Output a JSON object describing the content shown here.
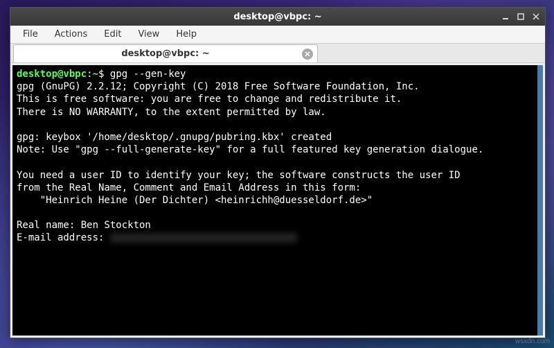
{
  "window": {
    "title": "desktop@vbpc: ~"
  },
  "menubar": {
    "items": [
      "File",
      "Actions",
      "Edit",
      "View",
      "Help"
    ]
  },
  "tab": {
    "label": "desktop@vbpc: ~"
  },
  "terminal": {
    "prompt_user": "desktop@vbpc",
    "prompt_path": "~",
    "prompt_symbol": "$",
    "command": "gpg --gen-key",
    "lines": [
      "gpg (GnuPG) 2.2.12; Copyright (C) 2018 Free Software Foundation, Inc.",
      "This is free software: you are free to change and redistribute it.",
      "There is NO WARRANTY, to the extent permitted by law.",
      "",
      "gpg: keybox '/home/desktop/.gnupg/pubring.kbx' created",
      "Note: Use \"gpg --full-generate-key\" for a full featured key generation dialogue.",
      "",
      "You need a user ID to identify your key; the software constructs the user ID",
      "from the Real Name, Comment and Email Address in this form:",
      "    \"Heinrich Heine (Der Dichter) <heinrichh@duesseldorf.de>\"",
      ""
    ],
    "real_name_label": "Real name: ",
    "real_name_value": "Ben Stockton",
    "email_label": "E-mail address: "
  },
  "watermark": "wsxdn.com"
}
